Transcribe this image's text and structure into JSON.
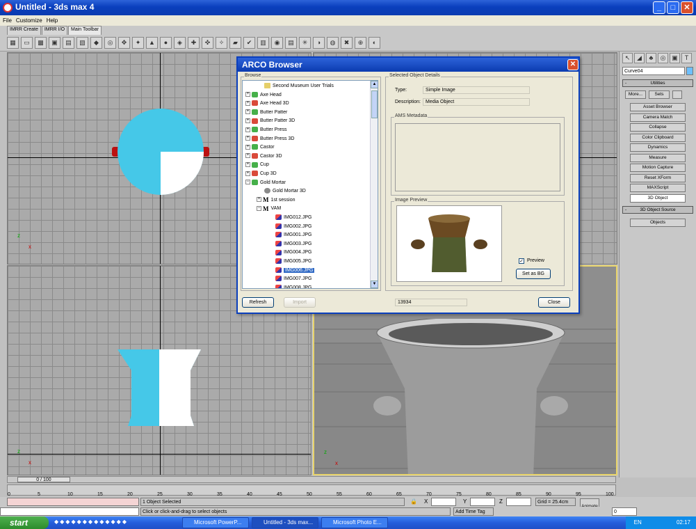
{
  "window": {
    "title": "Untitled - 3ds max 4",
    "controls": {
      "minimize": "_",
      "maximize": "□",
      "close": "✕"
    }
  },
  "menu": [
    "File",
    "Customize",
    "Help"
  ],
  "tabs": [
    "IMRR Create",
    "IMRR I/O",
    "Main Toolbar"
  ],
  "dialog": {
    "title": "ARCO Browser",
    "close": "✕",
    "browse_label": "Browse",
    "tree": [
      {
        "label": "Second Museum User Trials",
        "icon": "folder",
        "indent": 1,
        "expand": ""
      },
      {
        "label": "Axe Head",
        "icon": "green",
        "indent": 0,
        "expand": "+"
      },
      {
        "label": "Axe Head 3D",
        "icon": "red",
        "indent": 0,
        "expand": "+"
      },
      {
        "label": "Butter Patter",
        "icon": "green",
        "indent": 0,
        "expand": "+"
      },
      {
        "label": "Butter Patter 3D",
        "icon": "red",
        "indent": 0,
        "expand": "+"
      },
      {
        "label": "Butter Press",
        "icon": "green",
        "indent": 0,
        "expand": "+"
      },
      {
        "label": "Butter Press 3D",
        "icon": "red",
        "indent": 0,
        "expand": "+"
      },
      {
        "label": "Castor",
        "icon": "green",
        "indent": 0,
        "expand": "+"
      },
      {
        "label": "Castor 3D",
        "icon": "red",
        "indent": 0,
        "expand": "+"
      },
      {
        "label": "Cup",
        "icon": "green",
        "indent": 0,
        "expand": "+"
      },
      {
        "label": "Cup 3D",
        "icon": "red",
        "indent": 0,
        "expand": "+"
      },
      {
        "label": "Gold Mortar",
        "icon": "green",
        "indent": 0,
        "expand": "−"
      },
      {
        "label": "Gold Mortar 3D",
        "icon": "gray",
        "indent": 1,
        "expand": ""
      },
      {
        "label": "1st session",
        "icon": "M",
        "indent": 1,
        "expand": "+"
      },
      {
        "label": "VAM",
        "icon": "M",
        "indent": 1,
        "expand": "−"
      },
      {
        "label": "IMG012.JPG",
        "icon": "img",
        "indent": 2,
        "expand": ""
      },
      {
        "label": "IMG002.JPG",
        "icon": "img",
        "indent": 2,
        "expand": ""
      },
      {
        "label": "IMG001.JPG",
        "icon": "img",
        "indent": 2,
        "expand": ""
      },
      {
        "label": "IMG003.JPG",
        "icon": "img",
        "indent": 2,
        "expand": ""
      },
      {
        "label": "IMG004.JPG",
        "icon": "img",
        "indent": 2,
        "expand": ""
      },
      {
        "label": "IMG005.JPG",
        "icon": "img",
        "indent": 2,
        "expand": ""
      },
      {
        "label": "IMG006.JPG",
        "icon": "img",
        "indent": 2,
        "expand": "",
        "selected": true
      },
      {
        "label": "IMG007.JPG",
        "icon": "img",
        "indent": 2,
        "expand": ""
      },
      {
        "label": "IMG008.JPG",
        "icon": "img",
        "indent": 2,
        "expand": ""
      }
    ],
    "details_label": "Selected Object Details",
    "type_label": "Type:",
    "type_value": "Simple Image",
    "desc_label": "Description:",
    "desc_value": "Media Object",
    "ams_label": "AMS Metadata",
    "preview_label": "Image Preview",
    "preview_checkbox": "Preview",
    "preview_checked": "✓",
    "set_bg": "Set as BG",
    "refresh": "Refresh",
    "import": "Import",
    "id_value": "13934",
    "close_btn": "Close"
  },
  "cmdpanel": {
    "object_name": "Curve04",
    "utilities": "Utilities",
    "more": "More...",
    "sets": "Sets",
    "buttons": [
      "Asset Browser",
      "Camera Match",
      "Collapse",
      "Color Clipboard",
      "Dynamics",
      "Measure",
      "Motion Capture",
      "Reset XForm",
      "MAXScript",
      "3D Object"
    ],
    "rollout2": "3D Object Source",
    "objects": "Objects",
    "minus": "-"
  },
  "timeline": {
    "frame": "0 / 100",
    "ticks": [
      "0",
      "5",
      "10",
      "15",
      "20",
      "25",
      "30",
      "35",
      "40",
      "45",
      "50",
      "55",
      "60",
      "65",
      "70",
      "75",
      "80",
      "85",
      "90",
      "95",
      "100"
    ]
  },
  "status": {
    "selected": "1 Object Selected",
    "prompt": "Click or click-and-drag to select objects",
    "x_label": "X",
    "y_label": "Y",
    "z_label": "Z",
    "grid": "Grid = 25.4cm",
    "animate": "Animate",
    "add_time_tag": "Add Time Tag",
    "frame_field": "0"
  },
  "viewports": {
    "top_axis": "z",
    "x_axis": "x"
  },
  "taskbar": {
    "start": "start",
    "items": [
      "Microsoft PowerP...",
      "Untitled - 3ds max...",
      "Microsoft Photo E..."
    ],
    "lang": "EN",
    "clock": "02:17"
  },
  "colors": {
    "accent": "#0a3fbd",
    "selection": "#316ac5",
    "cyan_mesh": "#45c8e8"
  }
}
